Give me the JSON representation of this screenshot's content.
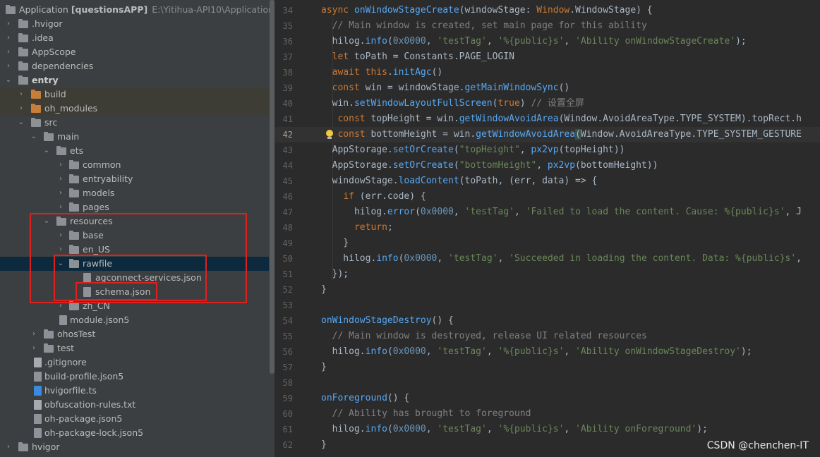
{
  "project_tree": {
    "root": {
      "name": "Application",
      "project": "[questionsAPP]",
      "path": "E:\\Yitihua-API10\\Application"
    },
    "items": [
      {
        "label": "Application",
        "depth": 0
      },
      {
        "label": ".hvigor",
        "depth": 0
      },
      {
        "label": ".idea",
        "depth": 0
      },
      {
        "label": "AppScope",
        "depth": 0
      },
      {
        "label": "dependencies",
        "depth": 0
      },
      {
        "label": "entry",
        "depth": 0
      },
      {
        "label": "build",
        "depth": 1
      },
      {
        "label": "oh_modules",
        "depth": 1
      },
      {
        "label": "src",
        "depth": 1
      },
      {
        "label": "main",
        "depth": 2
      },
      {
        "label": "ets",
        "depth": 3
      },
      {
        "label": "common",
        "depth": 4
      },
      {
        "label": "entryability",
        "depth": 4
      },
      {
        "label": "models",
        "depth": 4
      },
      {
        "label": "pages",
        "depth": 4
      },
      {
        "label": "resources",
        "depth": 3
      },
      {
        "label": "base",
        "depth": 4
      },
      {
        "label": "en_US",
        "depth": 4
      },
      {
        "label": "rawfile",
        "depth": 4
      },
      {
        "label": "agconnect-services.json",
        "depth": 5
      },
      {
        "label": "schema.json",
        "depth": 5
      },
      {
        "label": "zh_CN",
        "depth": 4
      },
      {
        "label": "module.json5",
        "depth": 3
      },
      {
        "label": "ohosTest",
        "depth": 2
      },
      {
        "label": "test",
        "depth": 2
      },
      {
        "label": ".gitignore",
        "depth": 1
      },
      {
        "label": "build-profile.json5",
        "depth": 1
      },
      {
        "label": "hvigorfile.ts",
        "depth": 1
      },
      {
        "label": "obfuscation-rules.txt",
        "depth": 1
      },
      {
        "label": "oh-package.json5",
        "depth": 1
      },
      {
        "label": "oh-package-lock.json5",
        "depth": 1
      },
      {
        "label": "hvigor",
        "depth": 0
      }
    ]
  },
  "editor": {
    "line_numbers": [
      "34",
      "35",
      "36",
      "37",
      "38",
      "39",
      "40",
      "41",
      "42",
      "43",
      "44",
      "45",
      "46",
      "47",
      "48",
      "49",
      "50",
      "51",
      "52",
      "53",
      "54",
      "55",
      "56",
      "57",
      "58",
      "59",
      "60",
      "61",
      "62"
    ],
    "current_line": "42"
  },
  "watermark": "CSDN @chenchen-IT",
  "colors": {
    "selection": "#0d293e",
    "annotation_red": "#e0201d",
    "editor_bg": "#2b2b2b",
    "sidebar_bg": "#3c3f41"
  }
}
